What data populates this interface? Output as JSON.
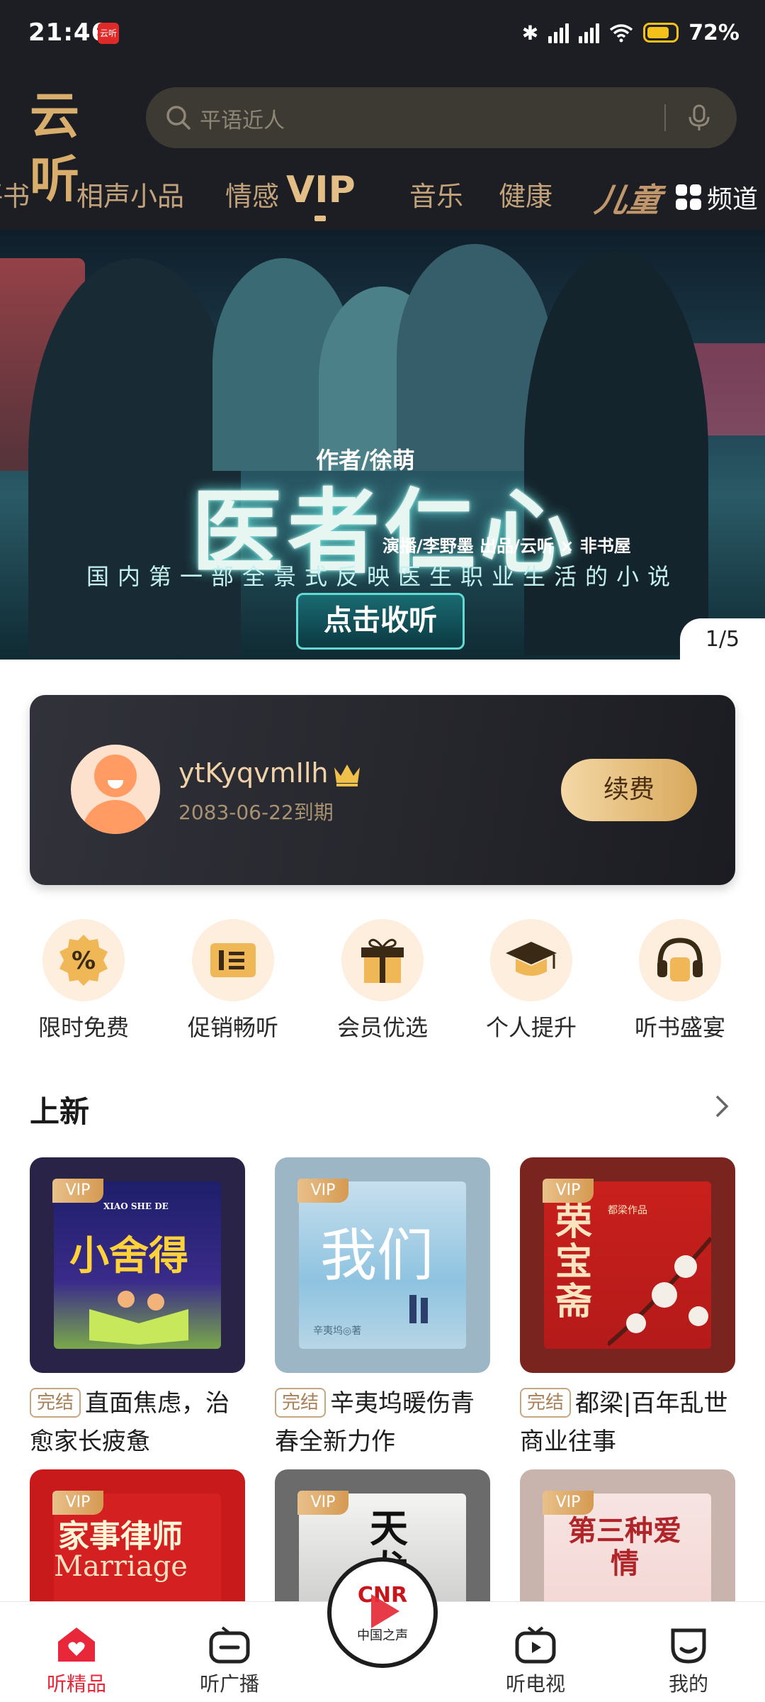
{
  "status_bar": {
    "time": "21:46",
    "app_icon_text": "云听",
    "battery": "72%"
  },
  "app": {
    "logo_text": "云听"
  },
  "search": {
    "placeholder": "平语近人"
  },
  "tabs": [
    {
      "label": "评书"
    },
    {
      "label": "相声小品"
    },
    {
      "label": "情感"
    },
    {
      "label": "VIP",
      "active": true
    },
    {
      "label": "音乐"
    },
    {
      "label": "健康"
    }
  ],
  "kids_badge": "儿童",
  "channel_button": "频道",
  "banner": {
    "author": "作者/徐萌",
    "title": "医者仁心",
    "credits": "演播/李野墨 出品/云听 × 非书屋",
    "slogan": "国内第一部全景式反映医生职业生活的小说",
    "cta": "点击收听",
    "page_indicator": "1/5"
  },
  "member": {
    "username": "ytKyqvmIlh",
    "expiry": "2083-06-22到期",
    "renew_label": "续费"
  },
  "quick_entries": [
    {
      "label": "限时免费",
      "icon": "discount-icon"
    },
    {
      "label": "促销畅听",
      "icon": "coupon-icon"
    },
    {
      "label": "会员优选",
      "icon": "gift-icon"
    },
    {
      "label": "个人提升",
      "icon": "graduation-cap-icon"
    },
    {
      "label": "听书盛宴",
      "icon": "headphones-icon"
    }
  ],
  "section": {
    "title": "上新"
  },
  "books": [
    {
      "vip": "VIP",
      "status": "完结",
      "title": "直面焦虑，治愈家长疲惫",
      "cover_text": "小舍得",
      "cover_sub": "XIAO SHE DE"
    },
    {
      "vip": "VIP",
      "status": "完结",
      "title": "辛夷坞暖伤青春全新力作",
      "cover_text": "我们",
      "cover_sub": "辛夷坞◎著"
    },
    {
      "vip": "VIP",
      "status": "完结",
      "title": "都梁|百年乱世商业往事",
      "cover_text": "荣宝斋",
      "cover_sub": "都梁作品"
    },
    {
      "vip": "VIP",
      "cover_text": "家事律师",
      "cover_sub": "Marriage"
    },
    {
      "vip": "VIP",
      "cover_text": "天龙"
    },
    {
      "vip": "VIP",
      "cover_text": "第三种爱情"
    }
  ],
  "bottom_nav": {
    "items": [
      {
        "label": "听精品",
        "active": true
      },
      {
        "label": "听广播"
      },
      {
        "label": "听电视"
      },
      {
        "label": "我的"
      }
    ],
    "center": {
      "brand": "CNR",
      "label": "中国之声"
    }
  },
  "colors": {
    "accent_gold": "#e3be87",
    "active_red": "#e8283a",
    "header_bg": "#1c1e24"
  }
}
